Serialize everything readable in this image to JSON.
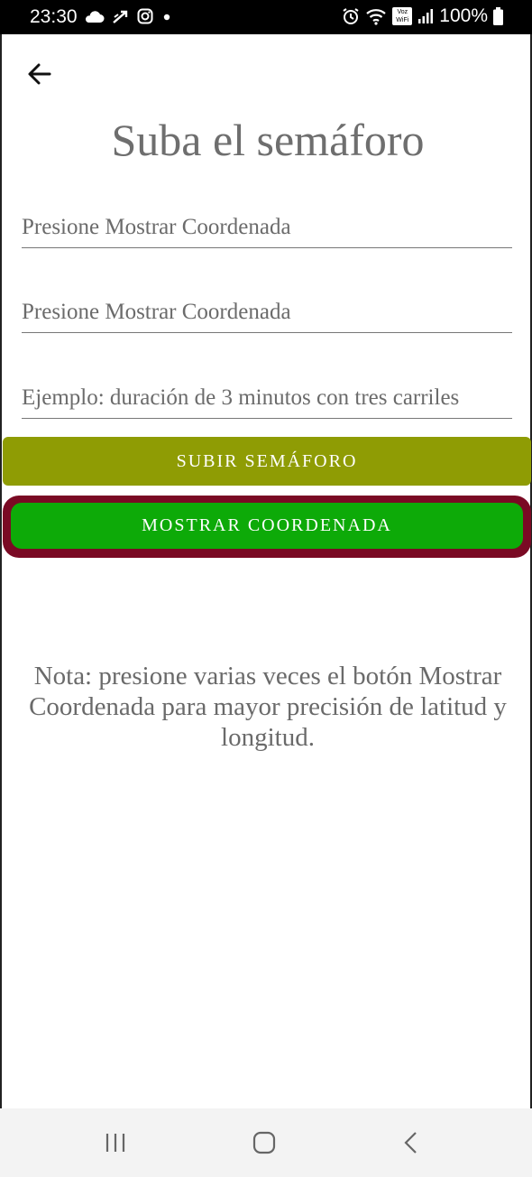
{
  "status_bar": {
    "time": "23:30",
    "battery_text": "100%",
    "left_icons": [
      "cloud-icon",
      "signal-arrow-icon",
      "instagram-icon",
      "dot-icon"
    ],
    "right_icons": [
      "alarm-icon",
      "wifi-icon",
      "voz-wifi-icon",
      "cell-signal-icon",
      "battery-icon"
    ],
    "voz_label": "Voz\nWiFi"
  },
  "header": {
    "back_icon": "arrow-left-icon",
    "title": "Suba el semáforo"
  },
  "form": {
    "field1_placeholder": "Presione Mostrar Coordenada",
    "field2_placeholder": "Presione Mostrar Coordenada",
    "field3_placeholder": "Ejemplo: duración de 3 minutos con tres carriles",
    "field1_value": "",
    "field2_value": "",
    "field3_value": ""
  },
  "buttons": {
    "upload_label": "SUBIR SEMÁFORO",
    "show_coord_label": "MOSTRAR COORDENADA"
  },
  "note": "Nota: presione varias veces el botón Mostrar Coordenada para mayor precisión de latitud y longitud.",
  "colors": {
    "upload_button": "#8f9c04",
    "show_coord_button": "#0daa08",
    "highlight_border": "#7a0a24"
  },
  "nav_bar": {
    "items": [
      "recent-apps-icon",
      "home-icon",
      "back-icon"
    ]
  }
}
